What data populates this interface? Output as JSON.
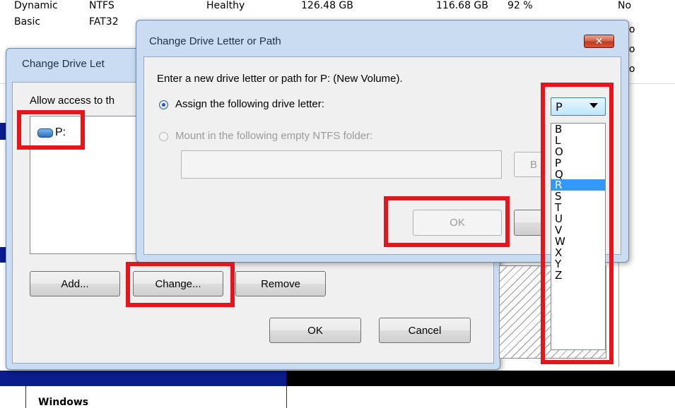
{
  "background": {
    "rows": [
      {
        "type": "Dynamic",
        "fs": "NTFS",
        "status": "Healthy",
        "capacity": "126.48 GB",
        "free": "116.68 GB",
        "pct": "92 %",
        "fault": "No"
      },
      {
        "type": "Basic",
        "fs": "FAT32",
        "status": "",
        "capacity": "",
        "free": "",
        "pct": "",
        "fault": ""
      }
    ],
    "fault_col_extra": [
      "lo",
      "lo",
      "lo"
    ],
    "volume_label": "Windows"
  },
  "outer_dialog": {
    "title": "Change Drive Let",
    "description": "Allow access to th",
    "list_items": [
      {
        "label": "P:",
        "icon": "drive-icon"
      }
    ],
    "buttons": {
      "add": "Add...",
      "change": "Change...",
      "remove": "Remove",
      "ok": "OK",
      "cancel": "Cancel"
    }
  },
  "inner_dialog": {
    "title": "Change Drive Letter or Path",
    "close_glyph": "✕",
    "prompt": "Enter a new drive letter or path for P: (New Volume).",
    "radio_assign": "Assign the following drive letter:",
    "radio_mount": "Mount in the following empty NTFS folder:",
    "mount_path_value": "",
    "browse_label": "B",
    "ok_label": "OK",
    "drive_letter": {
      "selected": "P",
      "highlighted": "R",
      "options": [
        "B",
        "L",
        "O",
        "P",
        "Q",
        "R",
        "S",
        "T",
        "U",
        "V",
        "W",
        "X",
        "Y",
        "Z"
      ]
    }
  },
  "colors": {
    "highlight": "#e8141c",
    "selection": "#3399ff",
    "title_bar": "#c9dcf2"
  }
}
